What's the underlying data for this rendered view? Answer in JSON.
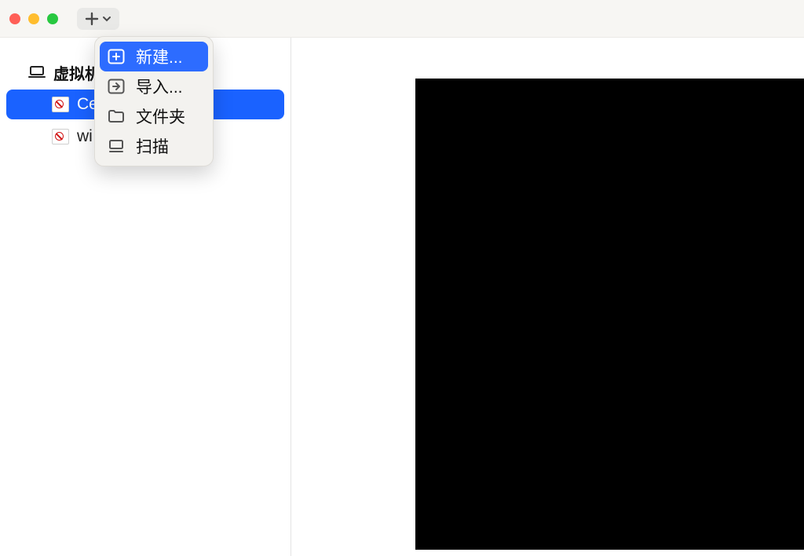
{
  "sidebar": {
    "group_label": "虚拟机",
    "items": [
      {
        "label": "Ce",
        "selected": true
      },
      {
        "label": "wi",
        "selected": false
      }
    ]
  },
  "menu": {
    "items": [
      {
        "label": "新建...",
        "highlighted": true,
        "icon": "plus-box-icon"
      },
      {
        "label": "导入...",
        "highlighted": false,
        "icon": "import-icon"
      },
      {
        "label": "文件夹",
        "highlighted": false,
        "icon": "folder-icon"
      },
      {
        "label": "扫描",
        "highlighted": false,
        "icon": "scan-icon"
      }
    ]
  }
}
